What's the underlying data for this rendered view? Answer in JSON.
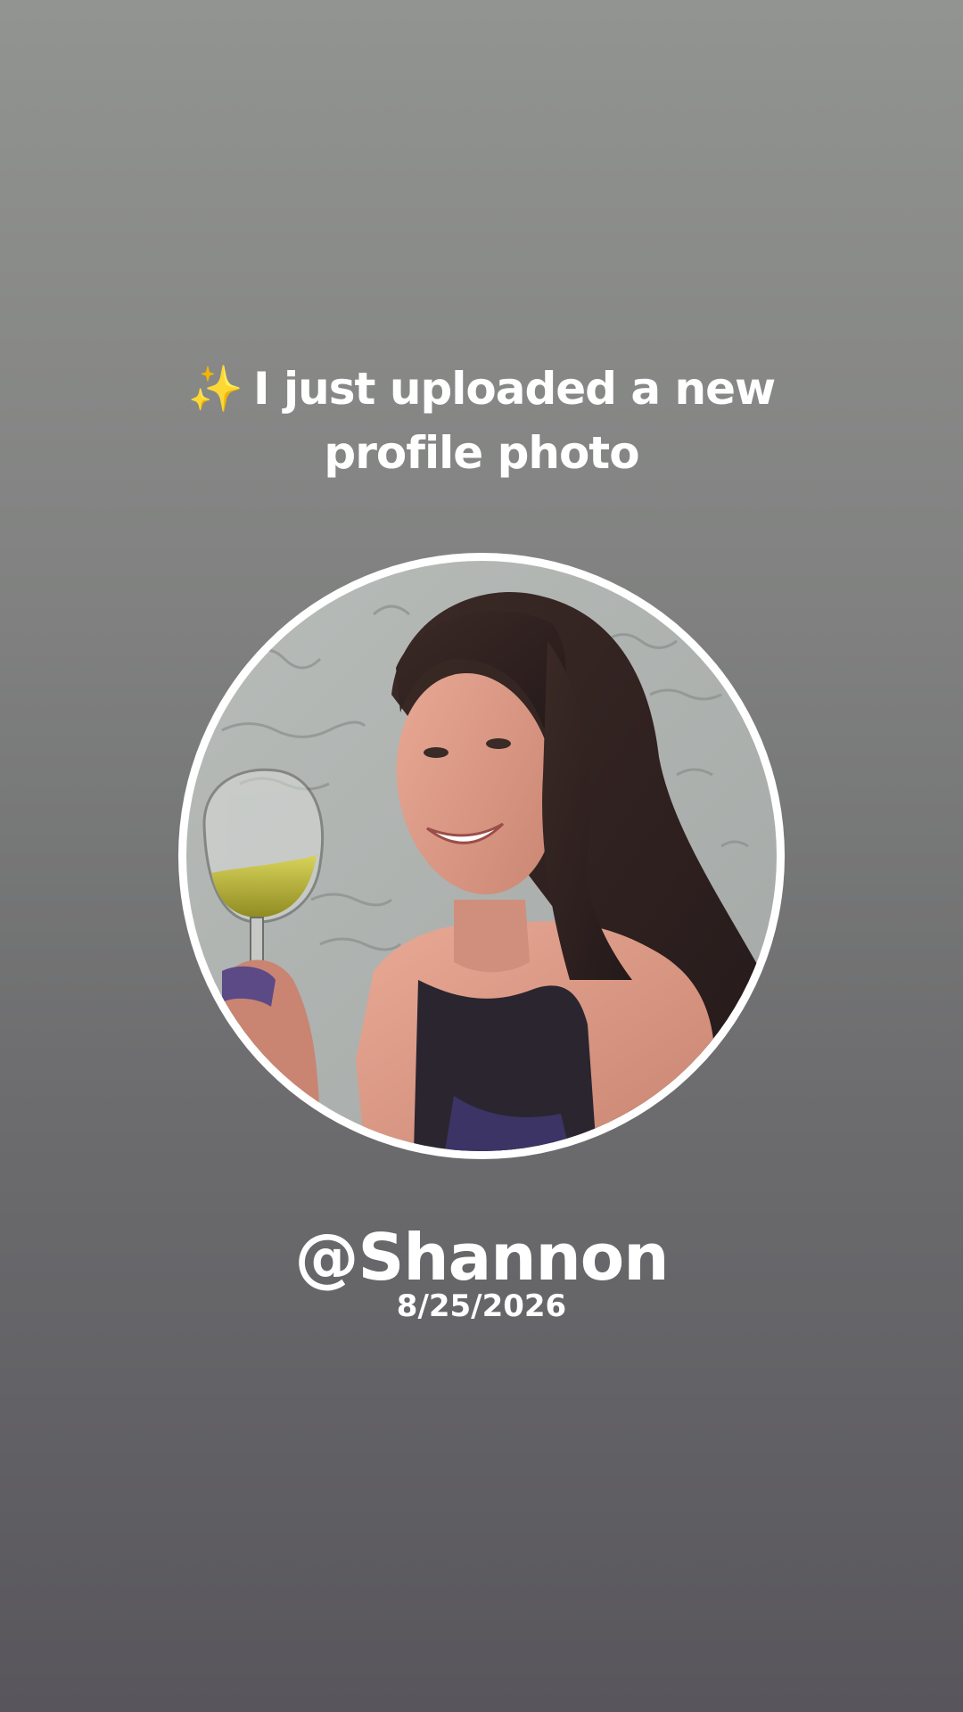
{
  "announcement": {
    "sparkle_icon": "✨",
    "text": "I just uploaded a new profile photo"
  },
  "profile": {
    "username": "@Shannon",
    "date": "8/25/2026",
    "photo_alt": "Profile photo of a smiling woman with long dark hair holding a glass of white wine"
  },
  "colors": {
    "background_top": "#929491",
    "background_bottom": "#58565c",
    "text": "#ffffff",
    "avatar_border": "#ffffff",
    "sparkle": "#f6c64a"
  }
}
